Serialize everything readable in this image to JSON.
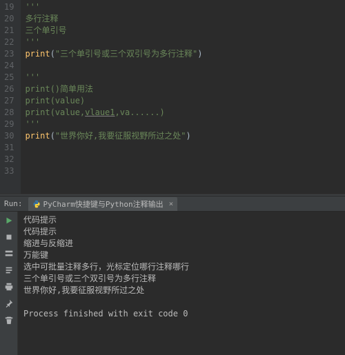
{
  "editor": {
    "lines": [
      {
        "n": "19",
        "html": "<span class='str'>'''</span>"
      },
      {
        "n": "20",
        "html": "<span class='str'>多行注释</span>"
      },
      {
        "n": "21",
        "html": "<span class='str'>三个单引号</span>"
      },
      {
        "n": "22",
        "html": "<span class='str'>'''</span>"
      },
      {
        "n": "23",
        "html": "<span class='fn'>print</span>(<span class='str'>\"三个单引号或三个双引号为多行注释\"</span>)"
      },
      {
        "n": "24",
        "html": ""
      },
      {
        "n": "25",
        "html": "<span class='str'>'''</span>"
      },
      {
        "n": "26",
        "html": "<span class='str'>print()简单用法</span>"
      },
      {
        "n": "27",
        "html": "<span class='str'>print(value)</span>"
      },
      {
        "n": "28",
        "html": "<span class='str'>print(value,<span class='underline'>vlaue1</span>,va......)</span>"
      },
      {
        "n": "29",
        "html": "<span class='str'>'''</span>"
      },
      {
        "n": "30",
        "html": "<span class='fn'>print</span>(<span class='str'>\"世界你好,我要征服视野所过之处\"</span>)"
      },
      {
        "n": "31",
        "html": ""
      },
      {
        "n": "32",
        "html": ""
      },
      {
        "n": "33",
        "html": ""
      }
    ]
  },
  "run": {
    "label": "Run:",
    "tab": "PyCharm快捷键与Python注释输出",
    "output": [
      "代码提示",
      "代码提示",
      "缩进与反缩进",
      "万能键",
      "选中可批量注释多行，光标定位哪行注释哪行",
      "三个单引号或三个双引号为多行注释",
      "世界你好,我要征服视野所过之处",
      "",
      "Process finished with exit code 0"
    ]
  }
}
